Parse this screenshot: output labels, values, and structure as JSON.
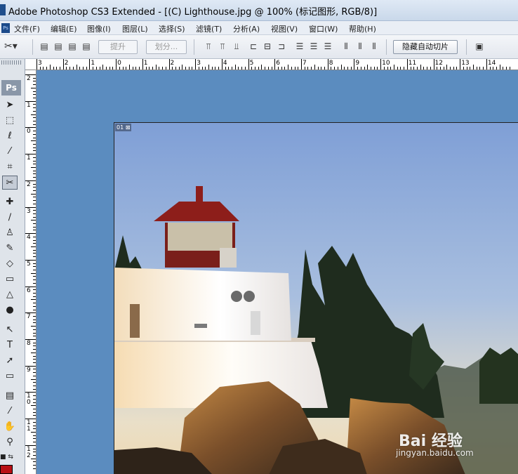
{
  "window": {
    "title": "Adobe Photoshop CS3 Extended - [(C) Lighthouse.jpg @ 100% (标记图形, RGB/8)]"
  },
  "menu": {
    "items": [
      "文件(F)",
      "编辑(E)",
      "图像(I)",
      "图层(L)",
      "选择(S)",
      "滤镜(T)",
      "分析(A)",
      "视图(V)",
      "窗口(W)",
      "帮助(H)"
    ]
  },
  "options_bar": {
    "promote_label": "提升",
    "divide_label": "划分...",
    "hide_auto_slices_label": "隐藏自动切片"
  },
  "toolbox": {
    "logo": "Ps",
    "foreground_color": "#b80f14"
  },
  "rulers": {
    "top_labels": [
      "3",
      "2",
      "1",
      "0",
      "1",
      "2",
      "3",
      "4",
      "5",
      "6",
      "7",
      "8",
      "9",
      "10",
      "11",
      "12",
      "13",
      "14"
    ],
    "left_labels": [
      "2",
      "1",
      "0",
      "1",
      "2",
      "3",
      "4",
      "5",
      "6",
      "7",
      "8",
      "9",
      "1\n0",
      "1\n1",
      "1\n2"
    ]
  },
  "document": {
    "slice_label": "01"
  },
  "watermark": {
    "brand": "Bai 经验",
    "url": "jingyan.baidu.com"
  },
  "colors": {
    "workspace": "#5b8cbf",
    "accent": "#b80f14"
  }
}
